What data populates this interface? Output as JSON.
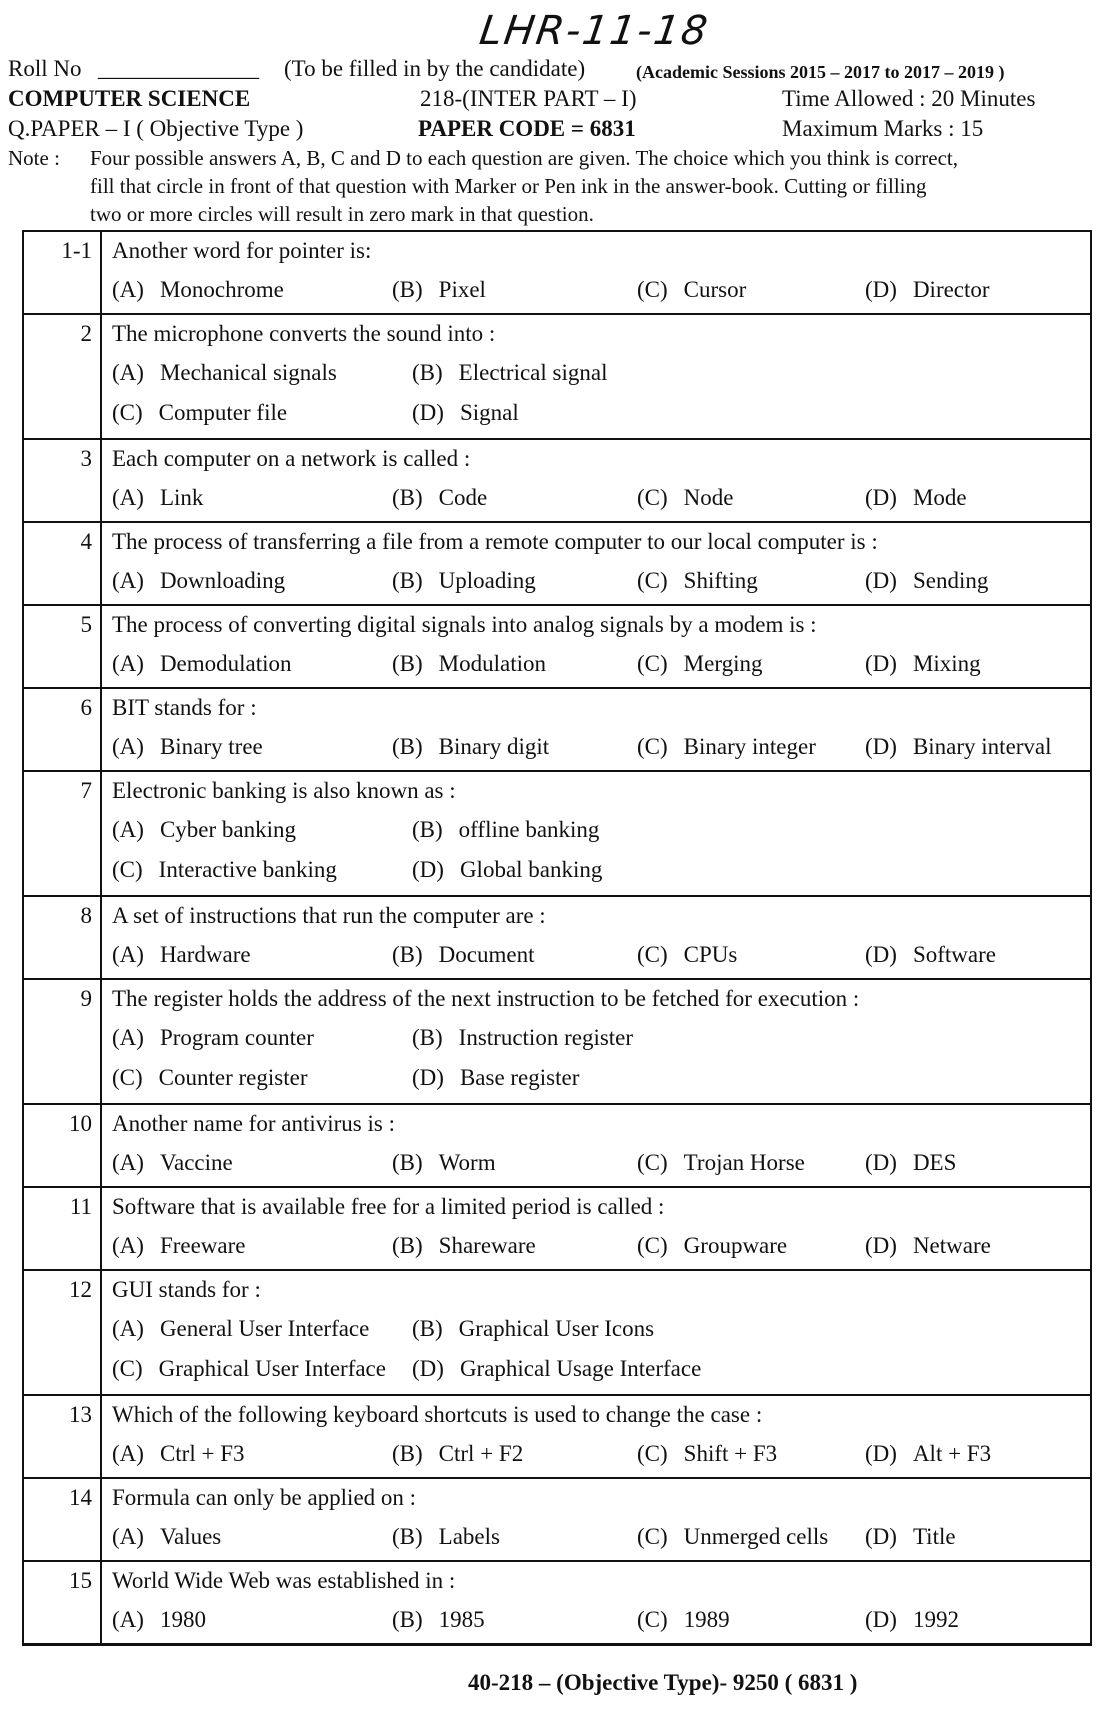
{
  "header": {
    "handwritten": "LHR-11-18",
    "roll_no": "Roll No",
    "roll_blank": "______________",
    "fill_note": "(To be filled in by the candidate)",
    "sessions": "(Academic Sessions 2015 – 2017 to 2017 – 2019 )",
    "subject": "COMPUTER SCIENCE",
    "part": "218-(INTER PART – I)",
    "time": "Time Allowed  :  20 Minutes",
    "paper": "Q.PAPER – I ( Objective Type )",
    "code": "PAPER CODE  =  6831",
    "marks": "Maximum Marks  :  15",
    "note_label": "Note  :",
    "note_1": "Four possible answers A, B, C and D to each question are given.  The choice which you think is correct,",
    "note_2": "fill  that  circle  in front of that question with Marker  or  Pen ink in the answer-book.   Cutting or filling",
    "note_3": "two or more circles will result in  zero mark in that question."
  },
  "questions": [
    {
      "num": "1-1",
      "text": "Another word for pointer is:",
      "layout": "4",
      "options": [
        [
          "(A)",
          "Monochrome"
        ],
        [
          "(B)",
          "Pixel"
        ],
        [
          "(C)",
          "Cursor"
        ],
        [
          "(D)",
          "Director"
        ]
      ]
    },
    {
      "num": "2",
      "text": "The microphone converts the sound into  :",
      "layout": "2",
      "options": [
        [
          "(A)",
          "Mechanical signals"
        ],
        [
          "(B)",
          "Electrical signal"
        ],
        [
          "(C)",
          "Computer file"
        ],
        [
          "(D)",
          "Signal"
        ]
      ]
    },
    {
      "num": "3",
      "text": "Each computer on a network is called  :",
      "layout": "4",
      "options": [
        [
          "(A)",
          "Link"
        ],
        [
          "(B)",
          "Code"
        ],
        [
          "(C)",
          "Node"
        ],
        [
          "(D)",
          "Mode"
        ]
      ]
    },
    {
      "num": "4",
      "text": "The process of transferring a file from a remote computer to our local computer is  :",
      "layout": "4",
      "options": [
        [
          "(A)",
          "Downloading"
        ],
        [
          "(B)",
          "Uploading"
        ],
        [
          "(C)",
          "Shifting"
        ],
        [
          "(D)",
          "Sending"
        ]
      ]
    },
    {
      "num": "5",
      "text": "The process of converting digital signals into analog signals by a modem is  :",
      "layout": "4",
      "options": [
        [
          "(A)",
          "Demodulation"
        ],
        [
          "(B)",
          "Modulation"
        ],
        [
          "(C)",
          "Merging"
        ],
        [
          "(D)",
          "Mixing"
        ]
      ]
    },
    {
      "num": "6",
      "text": "BIT stands for  :",
      "layout": "4",
      "options": [
        [
          "(A)",
          "Binary tree"
        ],
        [
          "(B)",
          "Binary digit"
        ],
        [
          "(C)",
          "Binary integer"
        ],
        [
          "(D)",
          "Binary interval"
        ]
      ]
    },
    {
      "num": "7",
      "text": "Electronic banking is also known as  :",
      "layout": "2",
      "options": [
        [
          "(A)",
          "Cyber banking"
        ],
        [
          "(B)",
          "offline banking"
        ],
        [
          "(C)",
          "Interactive banking"
        ],
        [
          "(D)",
          "Global banking"
        ]
      ]
    },
    {
      "num": "8",
      "text": "A set of instructions that run the computer are  :",
      "layout": "4",
      "options": [
        [
          "(A)",
          "Hardware"
        ],
        [
          "(B)",
          "Document"
        ],
        [
          "(C)",
          "CPUs"
        ],
        [
          "(D)",
          "Software"
        ]
      ]
    },
    {
      "num": "9",
      "text": "The register holds the address of the next instruction to be fetched for execution  :",
      "layout": "2",
      "options": [
        [
          "(A)",
          "Program counter"
        ],
        [
          "(B)",
          "Instruction register"
        ],
        [
          "(C)",
          "Counter register"
        ],
        [
          "(D)",
          "Base register"
        ]
      ]
    },
    {
      "num": "10",
      "text": "Another name for antivirus is  :",
      "layout": "4",
      "options": [
        [
          "(A)",
          "Vaccine"
        ],
        [
          "(B)",
          "Worm"
        ],
        [
          "(C)",
          "Trojan Horse"
        ],
        [
          "(D)",
          "DES"
        ]
      ]
    },
    {
      "num": "11",
      "text": "Software that is available free for a limited period is called  :",
      "layout": "4",
      "options": [
        [
          "(A)",
          "Freeware"
        ],
        [
          "(B)",
          "Shareware"
        ],
        [
          "(C)",
          "Groupware"
        ],
        [
          "(D)",
          "Netware"
        ]
      ]
    },
    {
      "num": "12",
      "text": "GUI stands for  :",
      "layout": "2",
      "options": [
        [
          "(A)",
          "General User Interface"
        ],
        [
          "(B)",
          "Graphical User Icons"
        ],
        [
          "(C)",
          "Graphical User Interface"
        ],
        [
          "(D)",
          "Graphical Usage Interface"
        ]
      ]
    },
    {
      "num": "13",
      "text": "Which of the following keyboard shortcuts is used to change the case  :",
      "layout": "4",
      "options": [
        [
          "(A)",
          "Ctrl + F3"
        ],
        [
          "(B)",
          "Ctrl + F2"
        ],
        [
          "(C)",
          "Shift + F3"
        ],
        [
          "(D)",
          "Alt + F3"
        ]
      ]
    },
    {
      "num": "14",
      "text": "Formula can only be applied on  :",
      "layout": "4",
      "options": [
        [
          "(A)",
          "Values"
        ],
        [
          "(B)",
          "Labels"
        ],
        [
          "(C)",
          "Unmerged cells"
        ],
        [
          "(D)",
          "Title"
        ]
      ]
    },
    {
      "num": "15",
      "text": "World Wide Web was established in  :",
      "layout": "4",
      "options": [
        [
          "(A)",
          "1980"
        ],
        [
          "(B)",
          "1985"
        ],
        [
          "(C)",
          "1989"
        ],
        [
          "(D)",
          "1992"
        ]
      ]
    }
  ],
  "footer": "40-218 – (Objective Type)- 9250  ( 6831 )"
}
